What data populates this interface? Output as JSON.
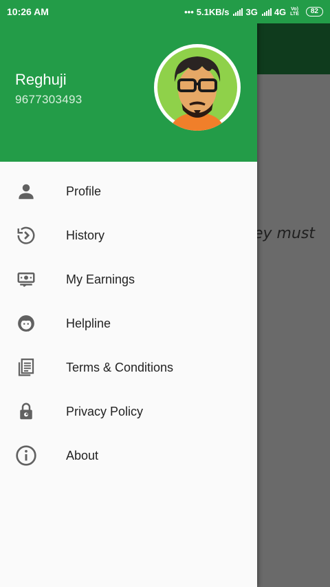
{
  "status_bar": {
    "time": "10:26 AM",
    "speed": "5.1KB/s",
    "net1": "3G",
    "net2": "4G",
    "volte_top": "Vo)",
    "volte_bottom": "LTE",
    "battery": "82"
  },
  "background": {
    "partial_text": "ey must"
  },
  "drawer": {
    "header": {
      "name": "Reghuji",
      "phone": "9677303493"
    },
    "items": [
      {
        "label": "Profile",
        "icon": "person-icon"
      },
      {
        "label": "History",
        "icon": "history-icon"
      },
      {
        "label": "My Earnings",
        "icon": "money-icon"
      },
      {
        "label": "Helpline",
        "icon": "support-agent-icon"
      },
      {
        "label": "Terms & Conditions",
        "icon": "document-icon"
      },
      {
        "label": "Privacy Policy",
        "icon": "lock-icon"
      },
      {
        "label": "About",
        "icon": "info-icon"
      }
    ]
  },
  "colors": {
    "primary": "#239c48",
    "dark_toolbar": "#0f3b1d",
    "icon": "#616161"
  }
}
